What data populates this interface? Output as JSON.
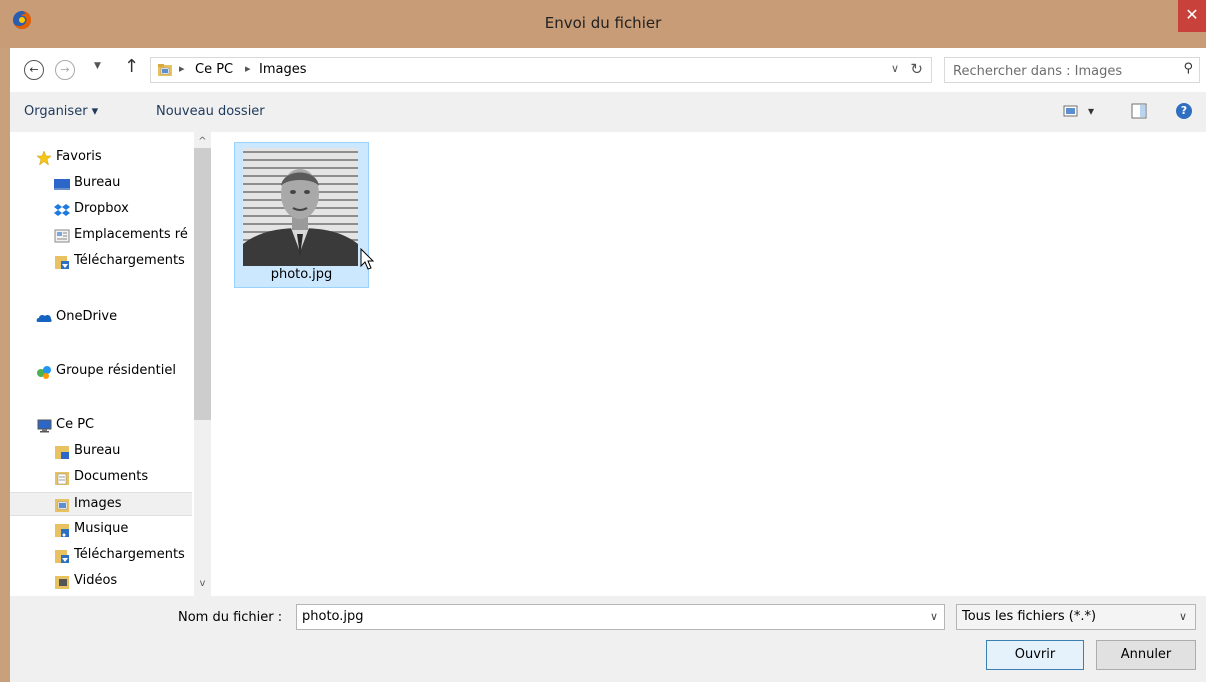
{
  "window": {
    "title": "Envoi du fichier",
    "close_glyph": "✕"
  },
  "address": {
    "separator": "▸",
    "crumbs": [
      "Ce PC",
      "Images"
    ],
    "dropdown_glyph": "∨",
    "refresh_glyph": "↻"
  },
  "nav_buttons": {
    "back": "←",
    "forward": "→",
    "recent": "▼",
    "up": "↑"
  },
  "search": {
    "placeholder": "Rechercher dans : Images",
    "icon": "search-icon",
    "glyph": "⚲"
  },
  "toolbar": {
    "organize_label": "Organiser ▾",
    "new_folder_label": "Nouveau dossier",
    "view_dropdown_glyph": "▾",
    "help_glyph": "?"
  },
  "nav_pane": {
    "items": [
      {
        "label": "Favoris",
        "icon": "star-icon",
        "level": 0
      },
      {
        "label": "Bureau",
        "icon": "desktop-icon",
        "level": 1
      },
      {
        "label": "Dropbox",
        "icon": "dropbox-icon",
        "level": 1
      },
      {
        "label": "Emplacements ré",
        "icon": "recent-places-icon",
        "level": 1
      },
      {
        "label": "Téléchargements",
        "icon": "downloads-icon",
        "level": 1
      },
      {
        "label": "OneDrive",
        "icon": "onedrive-icon",
        "level": 0
      },
      {
        "label": "Groupe résidentiel",
        "icon": "homegroup-icon",
        "level": 0
      },
      {
        "label": "Ce PC",
        "icon": "computer-icon",
        "level": 0
      },
      {
        "label": "Bureau",
        "icon": "desktop-folder-icon",
        "level": 1
      },
      {
        "label": "Documents",
        "icon": "documents-icon",
        "level": 1
      },
      {
        "label": "Images",
        "icon": "pictures-icon",
        "level": 1,
        "selected": true
      },
      {
        "label": "Musique",
        "icon": "music-icon",
        "level": 1
      },
      {
        "label": "Téléchargements",
        "icon": "downloads-icon",
        "level": 1
      },
      {
        "label": "Vidéos",
        "icon": "videos-icon",
        "level": 1
      }
    ],
    "scroll_up_glyph": "^",
    "scroll_down_glyph": "v"
  },
  "files": [
    {
      "name": "photo.jpg",
      "selected": true
    }
  ],
  "footer": {
    "filename_label": "Nom du fichier :",
    "filename_value": "photo.jpg",
    "filetype_value": "Tous les fichiers (*.*)",
    "dropdown_glyph": "∨",
    "open_label": "Ouvrir",
    "cancel_label": "Annuler"
  },
  "colors": {
    "titlebar": "#c79c76",
    "close": "#c9413b",
    "selection": "#cce8ff",
    "selection_border": "#99d1ff"
  }
}
